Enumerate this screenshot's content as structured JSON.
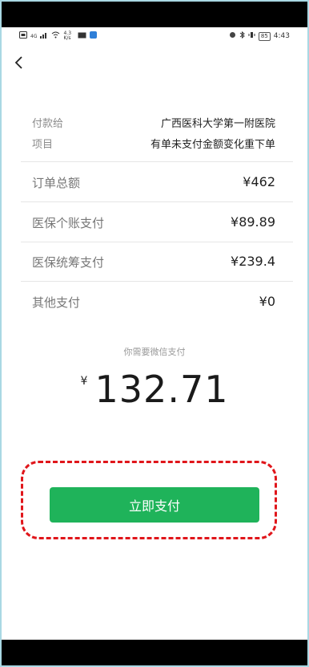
{
  "status_bar": {
    "signal_text": "4G",
    "network_speed": "4.3 K/s",
    "battery_level": "85",
    "time": "4:43",
    "icons": [
      "sim-icon",
      "signal-icon",
      "wifi-icon",
      "mail-icon",
      "app-notification-icon",
      "alarm-icon",
      "bluetooth-icon",
      "vibrate-icon",
      "battery-icon"
    ]
  },
  "nav": {
    "back_icon": "chevron-left-icon"
  },
  "info": {
    "payee_label": "付款给",
    "payee_value": "广西医科大学第一附医院",
    "item_label": "项目",
    "item_value": "有单未支付金额变化重下单"
  },
  "breakdown": [
    {
      "label": "订单总额",
      "value": "¥462"
    },
    {
      "label": "医保个账支付",
      "value": "¥89.89"
    },
    {
      "label": "医保统筹支付",
      "value": "¥239.4"
    },
    {
      "label": "其他支付",
      "value": "¥0"
    }
  ],
  "payment": {
    "note": "你需要微信支付",
    "currency": "¥",
    "amount": "132.71"
  },
  "action": {
    "pay_button_label": "立即支付"
  },
  "colors": {
    "accent_green": "#1fb35a",
    "highlight_red": "#e0161b",
    "frame_border": "#a9d8e3"
  }
}
